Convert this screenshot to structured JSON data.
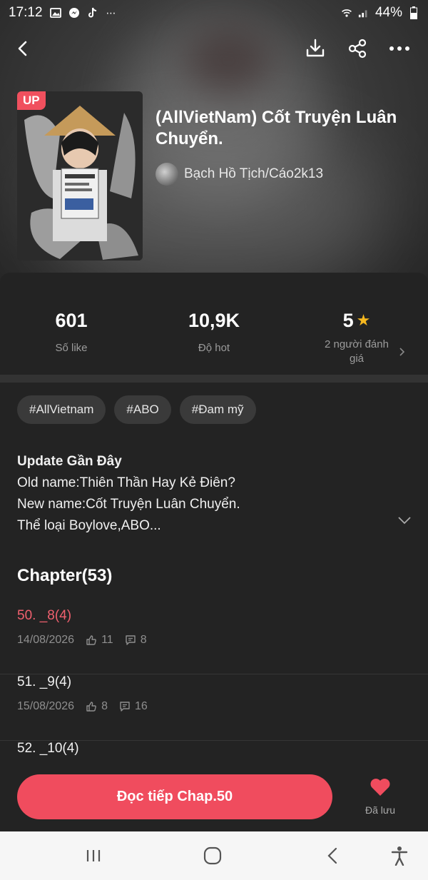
{
  "status_bar": {
    "time": "17:12",
    "battery": "44%"
  },
  "book": {
    "badge": "UP",
    "title": "(AllVietNam) Cốt Truyện Luân Chuyển.",
    "author": "Bạch Hồ Tịch/Cáo2k13"
  },
  "stats": {
    "likes": {
      "value": "601",
      "label": "Số like"
    },
    "hot": {
      "value": "10,9K",
      "label": "Độ hot"
    },
    "rating": {
      "value": "5",
      "label": "2 người đánh giá"
    }
  },
  "tags": [
    "#AllVietnam",
    "#ABO",
    "#Đam mỹ"
  ],
  "update": {
    "heading": "Update Gần Đây",
    "line1": "Old name:Thiên Thần Hay Kẻ Điên?",
    "line2": "New name:Cốt Truyện Luân Chuyển.",
    "line3": "Thể loại Boylove,ABO..."
  },
  "chapters": {
    "heading": "Chapter(53)",
    "items": [
      {
        "name": "50. _8(4)",
        "date": "14/08/2026",
        "likes": "11",
        "comments": "8"
      },
      {
        "name": "51. _9(4)",
        "date": "15/08/2026",
        "likes": "8",
        "comments": "16"
      },
      {
        "name": "52. _10(4)",
        "date": "",
        "likes": "",
        "comments": ""
      }
    ]
  },
  "actions": {
    "read_label": "Đọc tiếp Chap.50",
    "saved_label": "Đã lưu"
  },
  "colors": {
    "accent": "#f04c5e",
    "star": "#f6b81f",
    "background": "#232323"
  }
}
